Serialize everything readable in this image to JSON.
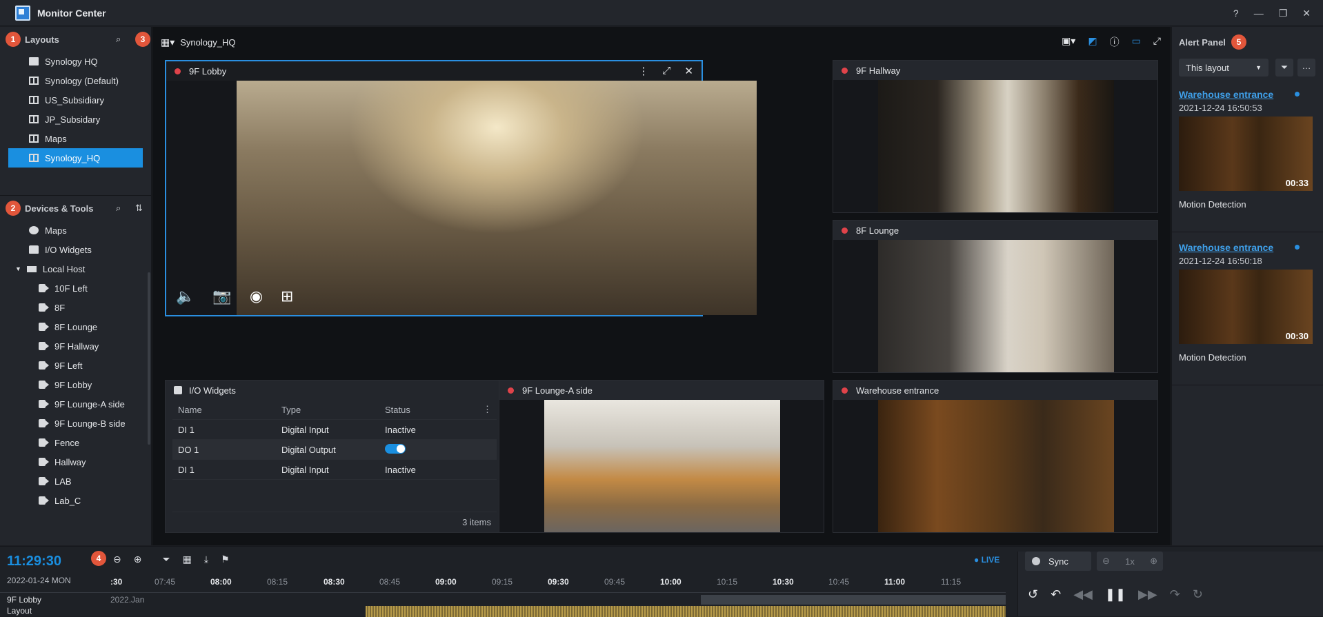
{
  "app": {
    "title": "Monitor Center"
  },
  "layouts": {
    "badge": "1",
    "title": "Layouts",
    "items": [
      {
        "label": "Synology HQ",
        "icon": "folder-icon"
      },
      {
        "label": "Synology (Default)",
        "icon": "layout-icon"
      },
      {
        "label": "US_Subsidiary",
        "icon": "layout-icon"
      },
      {
        "label": "JP_Subsidary",
        "icon": "layout-icon"
      },
      {
        "label": "Maps",
        "icon": "layout-icon"
      },
      {
        "label": "Synology_HQ",
        "icon": "layout-icon",
        "selected": true
      }
    ]
  },
  "devices": {
    "badge": "2",
    "title": "Devices & Tools",
    "items": [
      "Maps",
      "I/O Widgets",
      "Local Host",
      "10F Left",
      "8F",
      "8F Lounge",
      "9F Hallway",
      "9F Left",
      "9F Lobby",
      "9F Lounge-A side",
      "9F Lounge-B side",
      "Fence",
      "Hallway",
      "LAB",
      "Lab_C"
    ]
  },
  "toolbar": {
    "badge": "3",
    "layout_name": "Synology_HQ"
  },
  "tiles": {
    "lobby": "9F Lobby",
    "hallway": "9F Hallway",
    "lounge": "8F Lounge",
    "loungea": "9F Lounge-A side",
    "warehouse": "Warehouse entrance"
  },
  "io": {
    "title": "I/O Widgets",
    "headers": [
      "Name",
      "Type",
      "Status"
    ],
    "rows": [
      {
        "name": "DI 1",
        "type": "Digital Input",
        "status": "Inactive"
      },
      {
        "name": "DO 1",
        "type": "Digital Output",
        "status": ""
      },
      {
        "name": "DI 1",
        "type": "Digital Input",
        "status": "Inactive"
      }
    ],
    "count": "3 items"
  },
  "alerts": {
    "badge": "5",
    "title": "Alert Panel",
    "filter": "This layout",
    "cards": [
      {
        "title": "Warehouse entrance",
        "time": "2021-12-24 16:50:53",
        "duration": "00:33",
        "type": "Motion Detection"
      },
      {
        "title": "Warehouse entrance",
        "time": "2021-12-24 16:50:18",
        "duration": "00:30",
        "type": "Motion Detection"
      }
    ]
  },
  "timeline": {
    "badge": "4",
    "clock": "11:29:30",
    "date": "2022-01-24 MON",
    "live": "LIVE",
    "sync": "Sync",
    "speed": "1x",
    "month": "2022.Jan",
    "ticks": [
      ":30",
      "07:45",
      "08:00",
      "08:15",
      "08:30",
      "08:45",
      "09:00",
      "09:15",
      "09:30",
      "09:45",
      "10:00",
      "10:15",
      "10:30",
      "10:45",
      "11:00",
      "11:15"
    ],
    "tracks": [
      "9F Lobby",
      "Layout"
    ]
  }
}
